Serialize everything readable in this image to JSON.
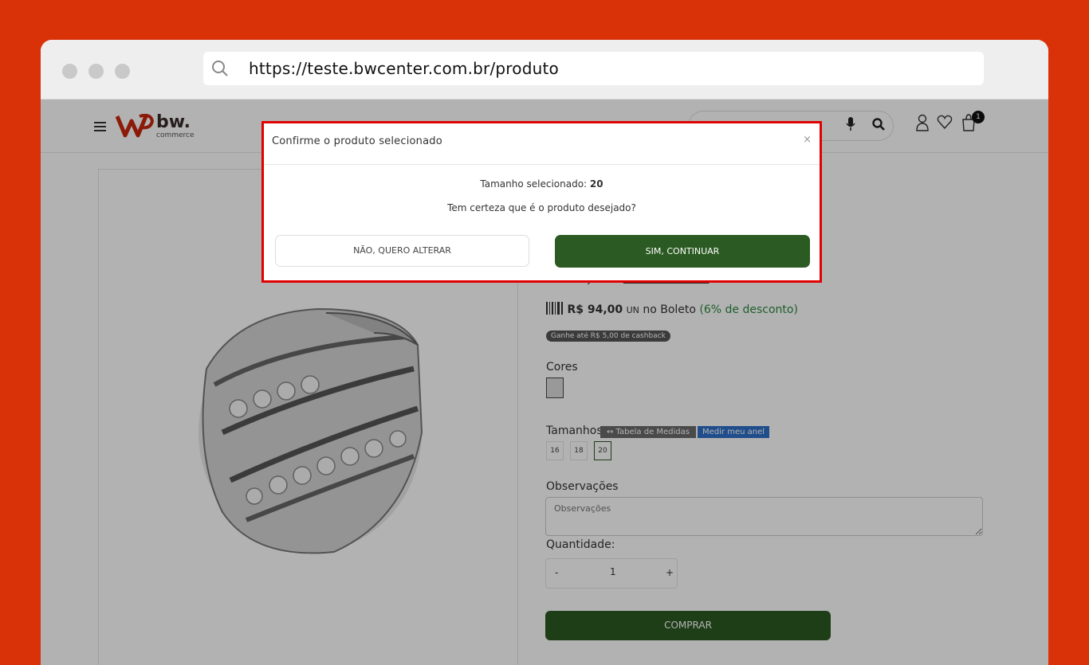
{
  "browser": {
    "url": "https://teste.bwcenter.com.br/produto"
  },
  "header": {
    "logo_text": "bw.",
    "logo_sub": "commerce",
    "cart_count": "1"
  },
  "product": {
    "parcelas_text": "67 sem juros - ",
    "parcelas_link": "Mostrar Parcelas",
    "boleto_price": "R$ 94,00",
    "boleto_unit": "UN",
    "boleto_label": "no Boleto",
    "boleto_discount": "(6% de desconto)",
    "cashback": "Ganhe até R$ 5,00 de cashback",
    "cores_label": "Cores",
    "tamanhos_label": "Tamanhos",
    "tabela_label": "↔ Tabela de Medidas",
    "medir_label": "Medir meu anel",
    "sizes": [
      "16",
      "18",
      "20"
    ],
    "obs_label": "Observações",
    "obs_placeholder": "Observações",
    "qty_label": "Quantidade:",
    "qty_minus": "-",
    "qty_value": "1",
    "qty_plus": "+",
    "buy_label": "COMPRAR"
  },
  "modal": {
    "title": "Confirme o produto selecionado",
    "close": "×",
    "size_prefix": "Tamanho selecionado: ",
    "size_value": "20",
    "question": "Tem certeza que é o produto desejado?",
    "no_label": "NÃO, QUERO ALTERAR",
    "yes_label": "SIM, CONTINUAR"
  },
  "colors": {
    "background": "#d93108",
    "primary_green": "#2b5a22",
    "modal_border": "#e00000"
  }
}
